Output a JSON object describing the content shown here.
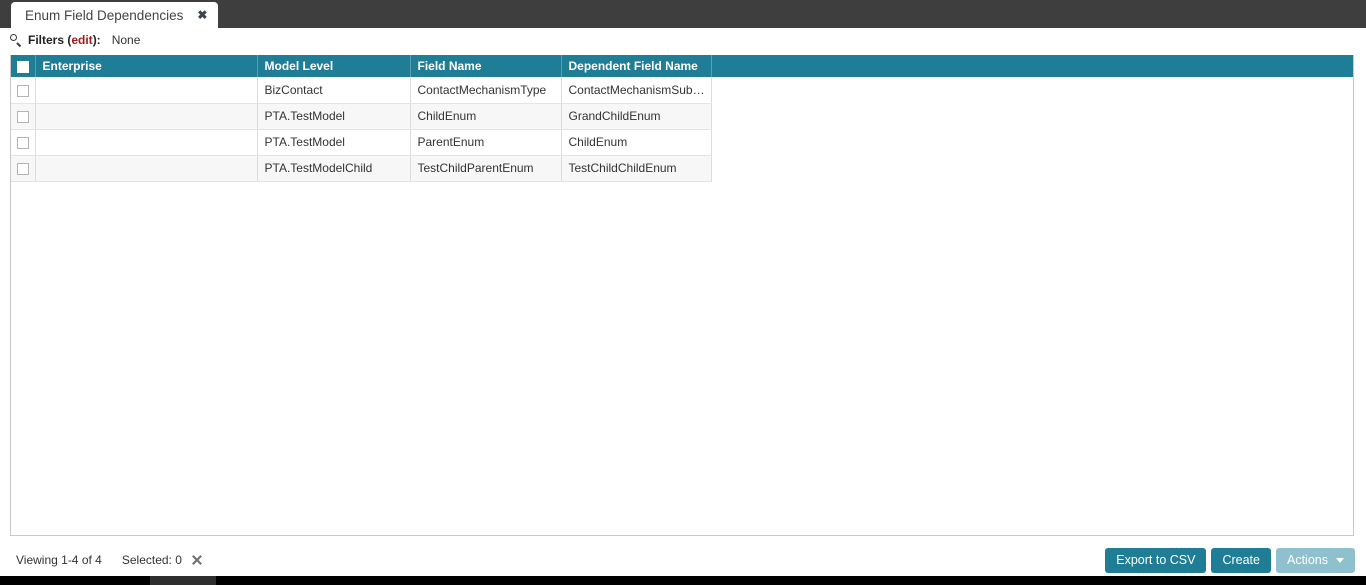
{
  "tab": {
    "title": "Enum Field Dependencies",
    "close_icon": "close-icon",
    "close_glyph": "✖"
  },
  "filters": {
    "search_icon": "search-icon",
    "label": "Filters (",
    "edit_label": "edit",
    "label_end": "):",
    "value": "None"
  },
  "grid": {
    "columns": [
      {
        "key": "check",
        "label": ""
      },
      {
        "key": "enterprise",
        "label": "Enterprise"
      },
      {
        "key": "model_level",
        "label": "Model Level"
      },
      {
        "key": "field_name",
        "label": "Field Name"
      },
      {
        "key": "dependent_field_name",
        "label": "Dependent Field Name"
      }
    ],
    "rows": [
      {
        "enterprise": "",
        "model_level": "BizContact",
        "field_name": "ContactMechanismType",
        "dependent_field_name": "ContactMechanismSubTy..."
      },
      {
        "enterprise": "",
        "model_level": "PTA.TestModel",
        "field_name": "ChildEnum",
        "dependent_field_name": "GrandChildEnum"
      },
      {
        "enterprise": "",
        "model_level": "PTA.TestModel",
        "field_name": "ParentEnum",
        "dependent_field_name": "ChildEnum"
      },
      {
        "enterprise": "",
        "model_level": "PTA.TestModelChild",
        "field_name": "TestChildParentEnum",
        "dependent_field_name": "TestChildChildEnum"
      }
    ]
  },
  "footer": {
    "viewing": "Viewing 1-4 of 4",
    "selected": "Selected: 0",
    "clear_selection_icon": "clear-selection-icon",
    "buttons": {
      "export_csv": "Export to CSV",
      "create": "Create",
      "actions": "Actions"
    }
  },
  "colors": {
    "tabbar_dark": "#3e3e3e",
    "header_teal": "#1f7d96",
    "button_teal": "#1f7d96",
    "button_muted_teal": "#8fc0cd",
    "edit_link_red": "#9b1c1c",
    "row_stripe": "#f7f7f7"
  }
}
